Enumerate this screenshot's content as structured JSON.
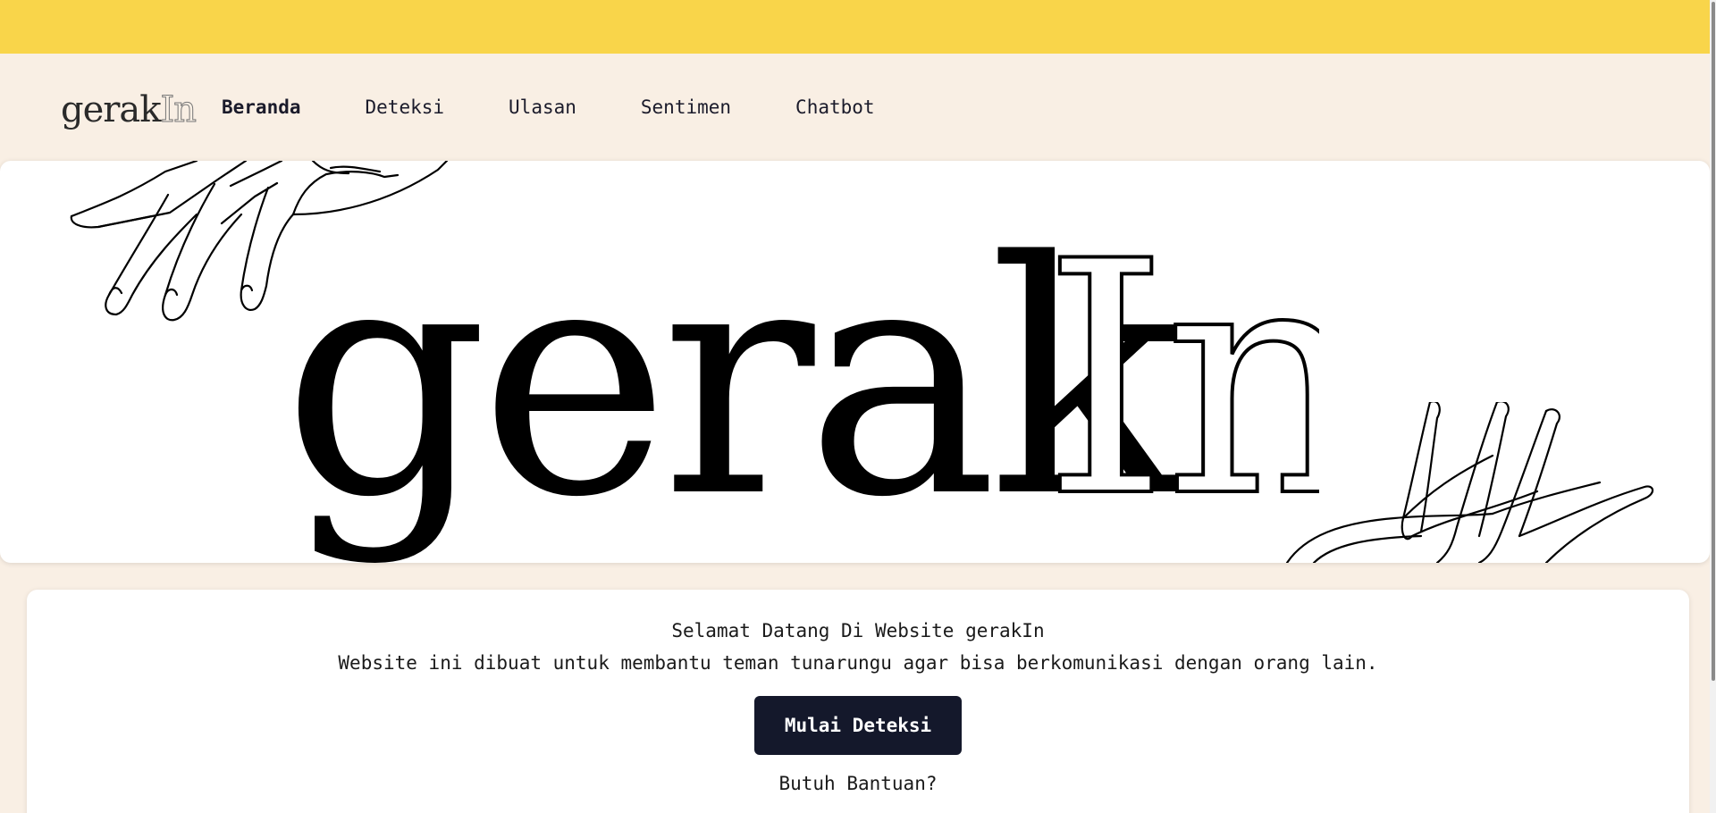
{
  "colors": {
    "top_strip": "#f9d54a",
    "page_bg": "#f9efe4",
    "button_bg": "#14182b"
  },
  "nav": {
    "logo_main": "gerak",
    "logo_accent": "In",
    "links": [
      {
        "label": "Beranda",
        "active": true
      },
      {
        "label": "Deteksi",
        "active": false
      },
      {
        "label": "Ulasan",
        "active": false
      },
      {
        "label": "Sentimen",
        "active": false
      },
      {
        "label": "Chatbot",
        "active": false
      }
    ]
  },
  "hero": {
    "wordmark_main": "gerak",
    "wordmark_accent": "In",
    "decoration_icons": [
      "hands-illustration-left",
      "hands-illustration-right"
    ]
  },
  "welcome": {
    "title": "Selamat Datang Di Website gerakIn",
    "description": "Website ini dibuat untuk membantu teman tunarungu agar bisa berkomunikasi dengan orang lain.",
    "button_label": "Mulai Deteksi",
    "help_label": "Butuh Bantuan?"
  }
}
